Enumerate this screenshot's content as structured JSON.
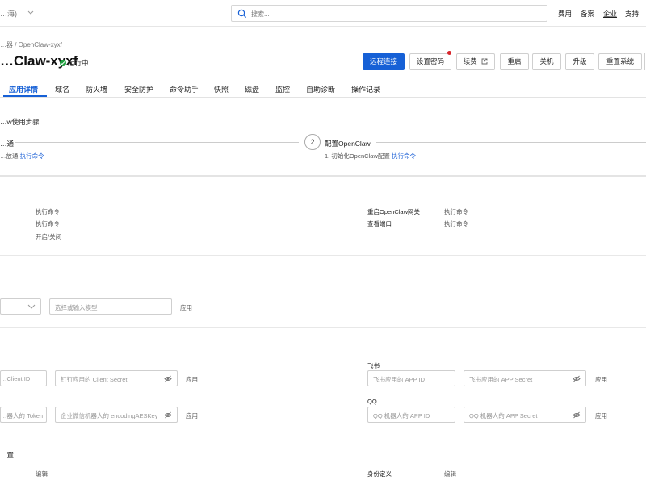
{
  "header": {
    "region_label": "…海)",
    "search_placeholder": "搜索...",
    "nav": [
      "费用",
      "备案",
      "企业",
      "支持"
    ]
  },
  "breadcrumb": "…器 / OpenClaw-xyxf",
  "instance": {
    "title": "…Claw-xyxf",
    "status": "运行中"
  },
  "actions": {
    "remote_connect": "远程连接",
    "set_password": "设置密码",
    "renew": "续费",
    "restart": "重启",
    "shutdown": "关机",
    "upgrade": "升级",
    "reset_system": "重置系统"
  },
  "tabs": [
    "应用详情",
    "域名",
    "防火墙",
    "安全防护",
    "命令助手",
    "快照",
    "磁盘",
    "监控",
    "自助诊断",
    "操作记录"
  ],
  "steps": {
    "section_title": "…w使用步骤",
    "step1_title": "…通",
    "step1_desc": "…放通",
    "step1_link": "执行命令",
    "step2_number": "2",
    "step2_title": "配置OpenClaw",
    "step2_desc": "1. 初始化OpenClaw配置",
    "step2_link": "执行命令"
  },
  "ops": {
    "left_links": [
      "执行命令",
      "执行命令",
      "开启/关闭"
    ],
    "right_rows": [
      {
        "label": "重启OpenClaw网关",
        "link": "执行命令"
      },
      {
        "label": "查看端口",
        "link": "执行命令"
      }
    ]
  },
  "model": {
    "input_placeholder": "选择或输入模型",
    "apply": "应用"
  },
  "channels": {
    "dingtalk_client_id": "…Client ID",
    "dingtalk_secret": "钉钉应用的 Client Secret",
    "apply1": "应用",
    "wecom_token": "…器人的 Token",
    "wecom_aes": "企业微信机器人的 encodingAESKey",
    "apply2": "应用",
    "feishu_label": "飞书",
    "feishu_app_id": "飞书应用的 APP ID",
    "feishu_secret": "飞书应用的 APP Secret",
    "apply3": "应用",
    "qq_label": "QQ",
    "qq_app_id": "QQ 机器人的 APP ID",
    "qq_secret": "QQ 机器人的 APP Secret",
    "apply4": "应用"
  },
  "config": {
    "section_title": "…置",
    "left_link": "编辑",
    "right_label": "身份定义",
    "right_link": "编辑"
  },
  "colors": {
    "primary": "#1660d6",
    "link": "#1a5fd6",
    "status_green": "#1e9e3e",
    "notice_red": "#d8262c"
  }
}
